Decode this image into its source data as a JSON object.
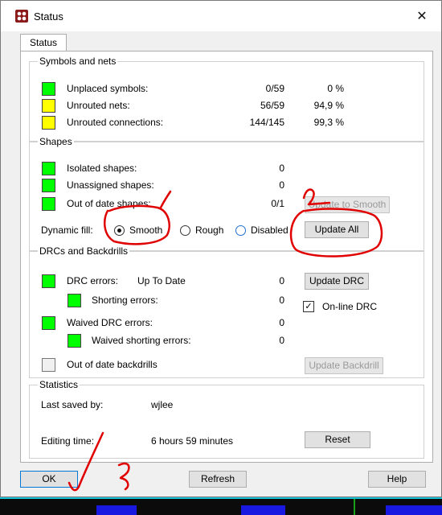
{
  "window": {
    "title": "Status",
    "close_glyph": "✕"
  },
  "tabs": [
    {
      "label": "Status"
    }
  ],
  "symbols_nets": {
    "title": "Symbols and nets",
    "rows": [
      {
        "label": "Unplaced symbols:",
        "count": "0/59",
        "pct": "0 %",
        "color": "#00ff00"
      },
      {
        "label": "Unrouted nets:",
        "count": "56/59",
        "pct": "94,9 %",
        "color": "#ffff00"
      },
      {
        "label": "Unrouted connections:",
        "count": "144/145",
        "pct": "99,3 %",
        "color": "#ffff00"
      }
    ]
  },
  "shapes": {
    "title": "Shapes",
    "rows": [
      {
        "label": "Isolated shapes:",
        "count": "0"
      },
      {
        "label": "Unassigned shapes:",
        "count": "0"
      },
      {
        "label": "Out of date shapes:",
        "count": "0/1"
      }
    ],
    "dynamic_fill_label": "Dynamic fill:",
    "fill_options": [
      "Smooth",
      "Rough",
      "Disabled"
    ],
    "fill_selected": "Smooth",
    "update_to_smooth_label": "Update to Smooth",
    "update_all_label": "Update All"
  },
  "drc": {
    "title": "DRCs and Backdrills",
    "drc_errors_label": "DRC errors:",
    "drc_status": "Up To Date",
    "drc_errors_count": "0",
    "shorting_errors_label": "Shorting errors:",
    "shorting_errors_count": "0",
    "waived_drc_label": "Waived DRC errors:",
    "waived_drc_count": "0",
    "waived_shorting_label": "Waived shorting errors:",
    "waived_shorting_count": "0",
    "backdrills_label": "Out of date backdrills",
    "update_drc_label": "Update DRC",
    "online_drc_label": "On-line DRC",
    "online_drc_checked": true,
    "update_backdrill_label": "Update Backdrill"
  },
  "statistics": {
    "title": "Statistics",
    "last_saved_label": "Last saved by:",
    "last_saved_value": "wjlee",
    "editing_time_label": "Editing time:",
    "editing_time_value": "6 hours 59 minutes",
    "reset_label": "Reset"
  },
  "footer": {
    "ok_label": "OK",
    "refresh_label": "Refresh",
    "help_label": "Help"
  },
  "annotation_color": "#e00000"
}
